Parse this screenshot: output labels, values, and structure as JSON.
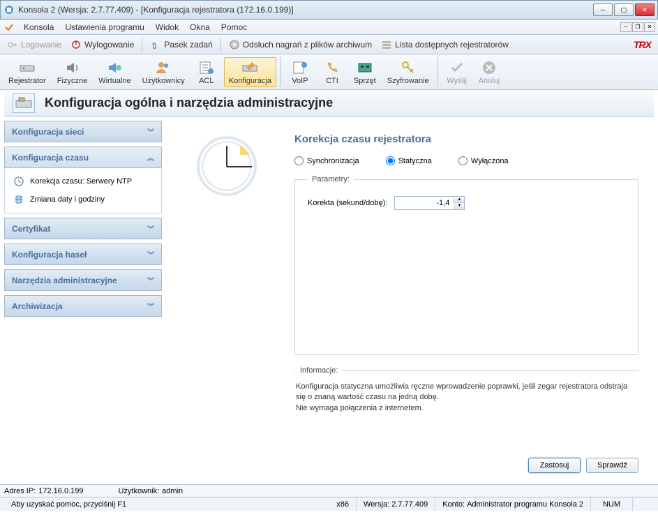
{
  "window": {
    "title": "Konsola 2 (Wersja:  2.7.77.409) - [Konfiguracja rejestratora (172.16.0.199)]"
  },
  "mainmenu": {
    "items": [
      "Konsola",
      "Ustawienia programu",
      "Widok",
      "Okna",
      "Pomoc"
    ]
  },
  "toolstrip": {
    "logowanie": "Logowanie",
    "wylogowanie": "Wylogowanie",
    "pasek": "Pasek zadań",
    "odsluch": "Odsłuch nagrań z plików archiwum",
    "lista": "Lista dostępnych rejestratorów",
    "logo": "TRX"
  },
  "bigtoolbar": [
    {
      "label": "Rejestrator",
      "name": "registrator"
    },
    {
      "label": "Fizyczne",
      "name": "fizyczne"
    },
    {
      "label": "Wirtualne",
      "name": "wirtualne"
    },
    {
      "label": "Użytkownicy",
      "name": "uzytkownicy"
    },
    {
      "label": "ACL",
      "name": "acl"
    },
    {
      "label": "Konfiguracja",
      "name": "konfiguracja",
      "active": true
    },
    {
      "label": "VoIP",
      "name": "voip"
    },
    {
      "label": "CTI",
      "name": "cti"
    },
    {
      "label": "Sprzęt",
      "name": "sprzet"
    },
    {
      "label": "Szyfrowanie",
      "name": "szyfrowanie"
    },
    {
      "label": "Wyślij",
      "name": "wyslij",
      "disabled": true
    },
    {
      "label": "Anuluj",
      "name": "anuluj",
      "disabled": true
    }
  ],
  "pagehead": {
    "title": "Konfiguracja ogólna i narzędzia administracyjne"
  },
  "sidebar": {
    "sections": [
      {
        "label": "Konfiguracja sieci",
        "expanded": false
      },
      {
        "label": "Konfiguracja czasu",
        "expanded": true,
        "items": [
          {
            "label": "Korekcja czasu: Serwery NTP",
            "icon": "clock-icon"
          },
          {
            "label": "Zmiana daty i godziny",
            "icon": "globe-icon"
          }
        ]
      },
      {
        "label": "Certyfikat",
        "expanded": false
      },
      {
        "label": "Konfiguracja haseł",
        "expanded": false
      },
      {
        "label": "Narzędzia administracyjne",
        "expanded": false
      },
      {
        "label": "Archiwizacja",
        "expanded": false
      }
    ]
  },
  "content": {
    "title": "Korekcja czasu rejestratora",
    "radios": {
      "sync": "Synchronizacja",
      "static": "Statyczna",
      "off": "Wyłączona",
      "selected": "static"
    },
    "params": {
      "legend": "Parametry:",
      "korekta_label": "Korekta (sekund/dobę):",
      "korekta_value": "-1,4"
    },
    "info": {
      "legend": "Informacje:",
      "text1": "Konfiguracja statyczna umożliwia ręczne wprowadzenie poprawki, jeśli zegar rejestratora odstraja się o znaną wartość czasu na jedną dobę.",
      "text2": "Nie wymaga połączenia z internetem."
    },
    "buttons": {
      "apply": "Zastosuj",
      "check": "Sprawdź"
    }
  },
  "status1": {
    "ip_label": "Adres IP:",
    "ip": "172.16.0.199",
    "user_label": "Użytkownik:",
    "user": "admin"
  },
  "status2": {
    "help": "Aby uzyskać pomoc, przyciśnij F1",
    "arch": "x86",
    "ver_label": "Wersja:",
    "ver": "2.7.77.409",
    "konto_label": "Konto:",
    "konto": "Administrator programu Konsola 2",
    "num": "NUM"
  }
}
